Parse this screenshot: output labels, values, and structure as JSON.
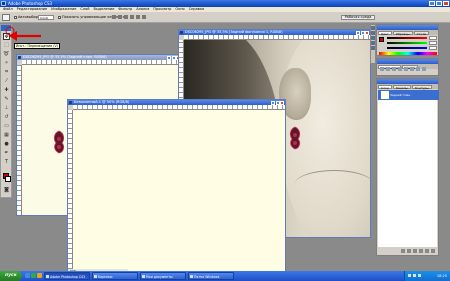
{
  "app": {
    "title": "Adobe Photoshop CS3"
  },
  "menu": [
    "Файл",
    "Редактирование",
    "Изображение",
    "Слой",
    "Выделение",
    "Фильтр",
    "Анализ",
    "Просмотр",
    "Окно",
    "Справка"
  ],
  "options_bar": {
    "autoselect_label": "Автовыбор:",
    "autoselect_value": "Слой",
    "show_controls_label": "Показать управляющие элементы",
    "workspace_label": "Рабочая среда"
  },
  "tool_tooltip": "Инст.: Перемещение (V)",
  "documents": {
    "back": {
      "title": "DSC06295_JPG @ 33,3% (Задний план, RGB/8)"
    },
    "photo": {
      "title": "DSC06295_JPG @ 33,3% (Задний фон/копия 1, RGB/8)"
    },
    "front": {
      "title": "Безымянный-1 @ 50% (RGB/8)",
      "status": "50%"
    }
  },
  "panels": {
    "color_tabs": [
      "Цвет",
      "Образцы",
      "Стили"
    ],
    "adjust_tabs": [
      "Коррекция",
      "Маски"
    ],
    "layers_tabs": [
      "Слои",
      "Каналы",
      "Контуры"
    ],
    "layer_name": "Задний план"
  },
  "taskbar": {
    "start_label": "пуск",
    "buttons": [
      "Adobe Photoshop CS3",
      "Кирпичи",
      "Мои документы",
      "Пятно Windows"
    ],
    "clock": "18:25"
  },
  "colors": {
    "foreground": "#cc0000",
    "annotation_arrow": "#e10000",
    "canvas": "#fffde4"
  }
}
